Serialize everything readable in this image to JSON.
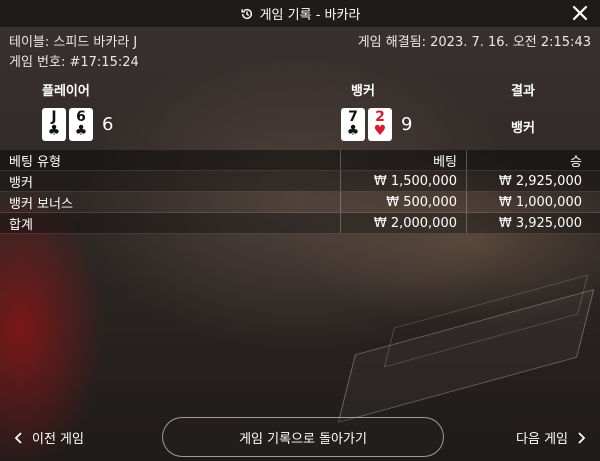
{
  "header": {
    "title": "게임 기록 - 바카라",
    "history_icon": "history-icon",
    "close_icon": "close-icon"
  },
  "info": {
    "table_label": "테이블: 스피드 바카라 J",
    "round_label": "게임 번호: #17:15:24",
    "settled_label": "게임 해결됨: 2023. 7. 16. 오전 2:15:43"
  },
  "hands": {
    "player_label": "플레이어",
    "banker_label": "뱅커",
    "result_label": "결과",
    "player_cards": [
      {
        "rank": "J",
        "suit": "♣",
        "color": "#111111"
      },
      {
        "rank": "6",
        "suit": "♣",
        "color": "#111111"
      }
    ],
    "player_score": "6",
    "banker_cards": [
      {
        "rank": "7",
        "suit": "♣",
        "color": "#111111"
      },
      {
        "rank": "2",
        "suit": "♥",
        "color": "#d81b2a"
      }
    ],
    "banker_score": "9",
    "result": "뱅커"
  },
  "bets": {
    "headers": [
      "베팅 유형",
      "베팅",
      "승"
    ],
    "rows": [
      [
        "뱅커",
        "₩ 1,500,000",
        "₩ 2,925,000"
      ],
      [
        "뱅커 보너스",
        "₩ 500,000",
        "₩ 1,000,000"
      ],
      [
        "합계",
        "₩ 2,000,000",
        "₩ 3,925,000"
      ]
    ]
  },
  "footer": {
    "prev_label": "이전 게임",
    "back_label": "게임 기록으로 돌아가기",
    "next_label": "다음 게임"
  }
}
